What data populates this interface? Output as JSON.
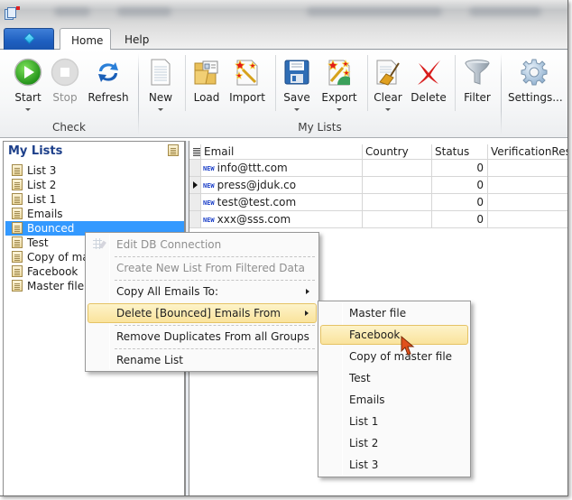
{
  "window": {
    "title_blurred": true
  },
  "ribbon": {
    "tabs": [
      {
        "label": "Home",
        "active": true
      },
      {
        "label": "Help",
        "active": false
      }
    ],
    "groups": [
      {
        "label": "Check",
        "buttons": [
          {
            "label": "Start",
            "icon": "play-icon",
            "has_dropdown": true,
            "enabled": true
          },
          {
            "label": "Stop",
            "icon": "stop-icon",
            "has_dropdown": false,
            "enabled": false
          },
          {
            "label": "Refresh",
            "icon": "refresh-icon",
            "has_dropdown": false,
            "enabled": true
          }
        ]
      },
      {
        "label": "My Lists",
        "buttons": [
          {
            "label": "New",
            "icon": "new-document-icon",
            "has_dropdown": true,
            "enabled": true
          },
          {
            "label": "Load",
            "icon": "folder-icon",
            "has_dropdown": false,
            "enabled": true
          },
          {
            "label": "Import",
            "icon": "import-wand-icon",
            "has_dropdown": false,
            "enabled": true
          },
          {
            "label": "Save",
            "icon": "floppy-disk-icon",
            "has_dropdown": true,
            "enabled": true
          },
          {
            "label": "Export",
            "icon": "export-wand-icon",
            "has_dropdown": true,
            "enabled": true
          },
          {
            "label": "Clear",
            "icon": "broom-icon",
            "has_dropdown": true,
            "enabled": true
          },
          {
            "label": "Delete",
            "icon": "red-x-icon",
            "has_dropdown": false,
            "enabled": true
          },
          {
            "label": "Filter",
            "icon": "funnel-icon",
            "has_dropdown": false,
            "enabled": true
          }
        ]
      },
      {
        "label": "",
        "buttons": [
          {
            "label": "Settings...",
            "icon": "gear-icon",
            "has_dropdown": false,
            "enabled": true
          }
        ]
      }
    ]
  },
  "left_panel": {
    "title": "My Lists",
    "items": [
      {
        "label": "List 3",
        "selected": false
      },
      {
        "label": "List 2",
        "selected": false
      },
      {
        "label": "List 1",
        "selected": false
      },
      {
        "label": "Emails",
        "selected": false
      },
      {
        "label": "Bounced",
        "selected": true
      },
      {
        "label": "Test",
        "selected": false
      },
      {
        "label": "Copy of master file",
        "selected": false
      },
      {
        "label": "Facebook",
        "selected": false
      },
      {
        "label": "Master file",
        "selected": false
      }
    ]
  },
  "grid": {
    "columns": [
      "Email",
      "Country",
      "Status",
      "VerificationResult"
    ],
    "new_badge": "NEW",
    "rows": [
      {
        "email": "info@ttt.com",
        "country": "",
        "status": "0",
        "verification": "",
        "current": false
      },
      {
        "email": "press@jduk.co",
        "country": "",
        "status": "0",
        "verification": "",
        "current": true
      },
      {
        "email": "test@test.com",
        "country": "",
        "status": "0",
        "verification": "",
        "current": false
      },
      {
        "email": "xxx@sss.com",
        "country": "",
        "status": "0",
        "verification": "",
        "current": false
      }
    ]
  },
  "context_menu": {
    "items": [
      {
        "label": "Edit DB Connection",
        "enabled": false,
        "submenu": false,
        "highlighted": false
      },
      {
        "label": "Create New List From Filtered Data",
        "enabled": false,
        "submenu": false,
        "highlighted": false
      },
      {
        "label": "Copy All Emails To:",
        "enabled": true,
        "submenu": true,
        "highlighted": false
      },
      {
        "label": "Delete [Bounced] Emails From",
        "enabled": true,
        "submenu": true,
        "highlighted": true
      },
      {
        "label": "Remove Duplicates From all Groups",
        "enabled": true,
        "submenu": false,
        "highlighted": false
      },
      {
        "label": "Rename List",
        "enabled": true,
        "submenu": false,
        "highlighted": false
      }
    ]
  },
  "submenu": {
    "items": [
      {
        "label": "Master file",
        "highlighted": false
      },
      {
        "label": "Facebook",
        "highlighted": true
      },
      {
        "label": "Copy of master file",
        "highlighted": false
      },
      {
        "label": "Test",
        "highlighted": false
      },
      {
        "label": "Emails",
        "highlighted": false
      },
      {
        "label": "List 1",
        "highlighted": false
      },
      {
        "label": "List 2",
        "highlighted": false
      },
      {
        "label": "List 3",
        "highlighted": false
      }
    ]
  },
  "colors": {
    "selection": "#3399ff",
    "menu_highlight": "#fae39c",
    "panel_title": "#1d3f8a",
    "new_badge": "#1a3ec8"
  }
}
